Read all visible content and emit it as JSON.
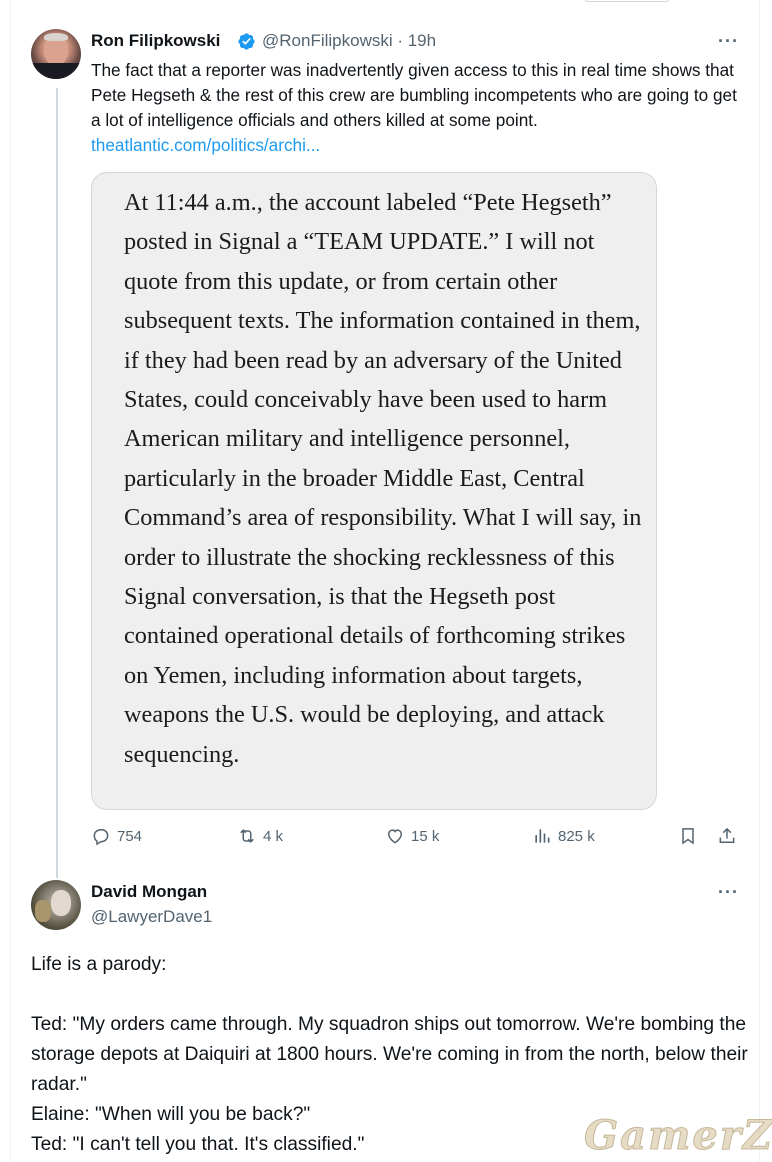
{
  "tweet": {
    "author_name": "Ron Filipkowski",
    "author_handle": "@RonFilipkowski · 19h",
    "more": "···",
    "text_before_link": "The fact that a reporter was inadvertently given access to this in real time shows that Pete Hegseth & the rest of this crew are bumbling incompetents who are going to get a lot of intelligence officials and others killed at some point. ",
    "link_text": "theatlantic.com/politics/archi...",
    "quote_image_text": "At 11:44 a.m., the account labeled “Pete Hegseth” posted in Signal a “TEAM UPDATE.” I will not quote from this update, or from certain other subsequent texts. The information contained in them, if they had been read by an adversary of the United States, could conceivably have been used to harm American military and intelligence personnel, particularly in the broader Middle East, Central Command’s area of responsibility. What I will say, in order to illustrate the shocking recklessness of this Signal conversation, is that the Hegseth post contained operational details of forthcoming strikes on Yemen, including information about targets, weapons the U.S. would be deploying, and attack sequencing.",
    "stats": {
      "replies": "754",
      "reposts": "4 k",
      "likes": "15 k",
      "views": "825 k"
    }
  },
  "reply": {
    "author_name": "David Mongan",
    "author_handle": "@LawyerDave1",
    "more": "···",
    "text": "Life is a parody:\n\nTed: \"My orders came through. My squadron ships out tomorrow. We're bombing the storage depots at Daiquiri at 1800 hours. We're coming in from the north, below their radar.\"\nElaine: \"When will you be back?\"\nTed: \"I can't tell you that. It's classified.\""
  },
  "watermark": "GamerZ",
  "colors": {
    "accent": "#1d9bf0",
    "secondary_text": "#536471",
    "quote_bg": "#efefef"
  }
}
